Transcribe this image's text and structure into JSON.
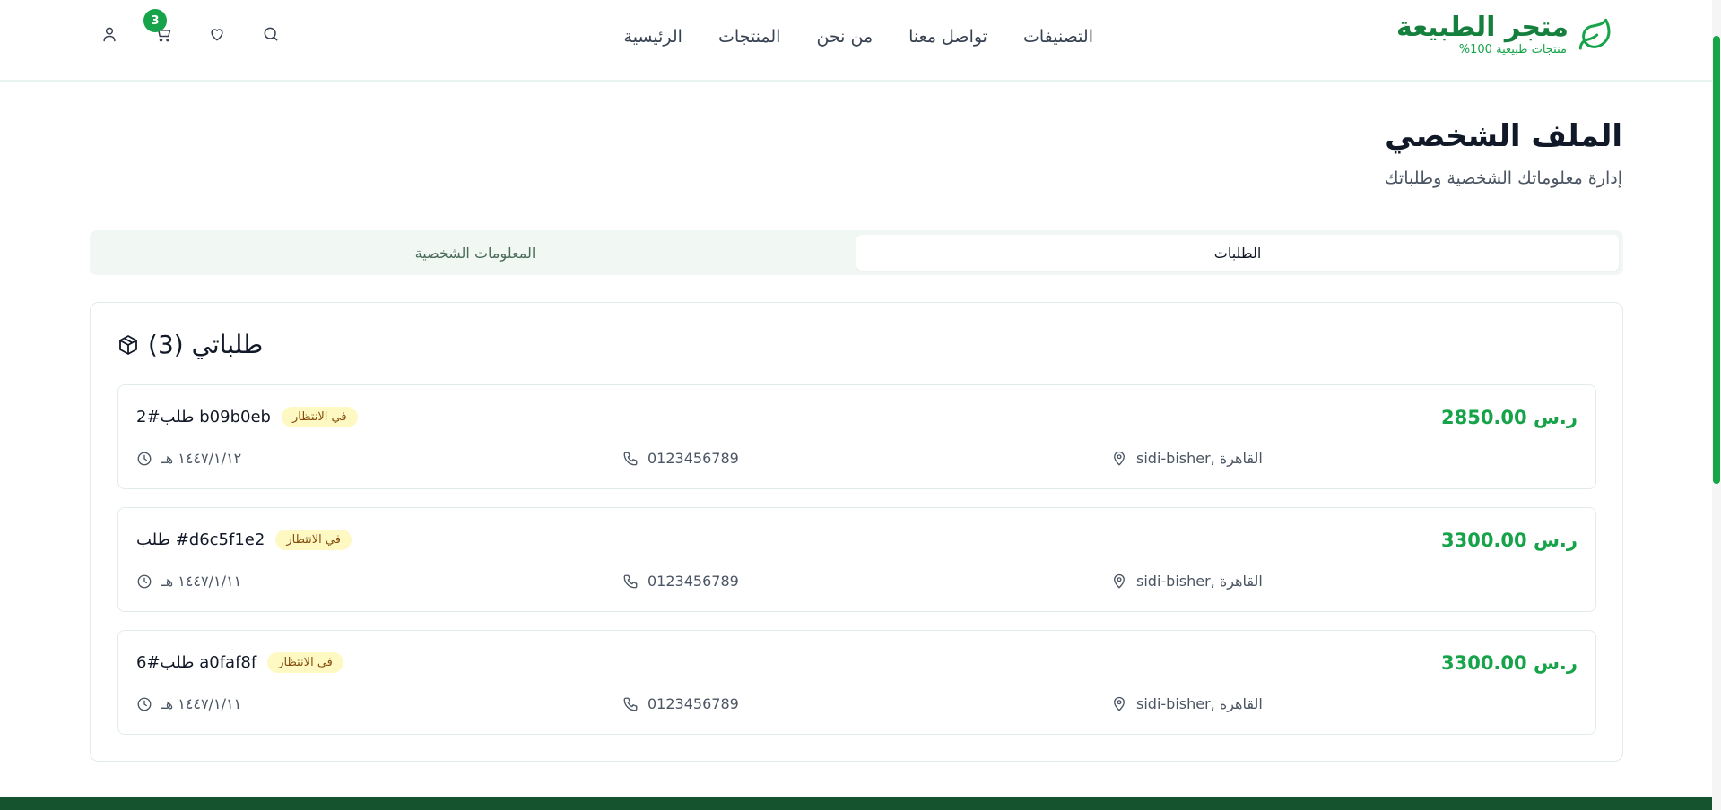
{
  "header": {
    "brand_name": "متجر الطبيعة",
    "brand_tagline": "منتجات طبيعية 100%",
    "nav": [
      "الرئيسية",
      "المنتجات",
      "من نحن",
      "تواصل معنا",
      "التصنيفات"
    ],
    "cart_count": "3",
    "icons": [
      "search-icon",
      "heart-icon",
      "cart-icon",
      "user-icon"
    ]
  },
  "page": {
    "title": "الملف الشخصي",
    "subtitle": "إدارة معلوماتك الشخصية وطلباتك"
  },
  "tabs": {
    "active": "الطلبات",
    "inactive": "المعلومات الشخصية"
  },
  "orders": {
    "title": "طلباتي (3)",
    "items": [
      {
        "id": "2#طلب b09b0eb",
        "status": "في الانتظار",
        "price": "2850.00 ر.س",
        "date": "١٤٤٧/١/١٢ هـ",
        "phone": "0123456789",
        "address": "sidi-bisher, القاهرة"
      },
      {
        "id": "طلب #d6c5f1e2",
        "status": "في الانتظار",
        "price": "3300.00 ر.س",
        "date": "١٤٤٧/١/١١ هـ",
        "phone": "0123456789",
        "address": "sidi-bisher, القاهرة"
      },
      {
        "id": "6#طلب a0faf8f",
        "status": "في الانتظار",
        "price": "3300.00 ر.س",
        "date": "١٤٤٧/١/١١ هـ",
        "phone": "0123456789",
        "address": "sidi-bisher, القاهرة"
      }
    ]
  },
  "colors": {
    "brand": "#15803d",
    "accent": "#16a34a",
    "status_bg": "#fef9c3",
    "footer": "#14532d"
  }
}
